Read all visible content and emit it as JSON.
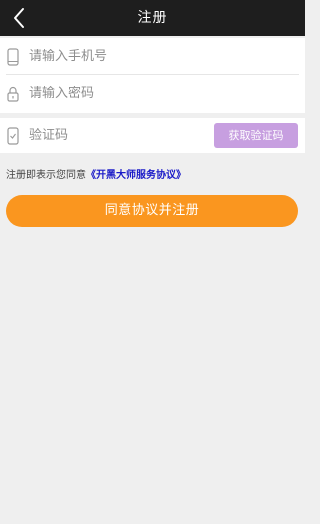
{
  "header": {
    "title": "注册",
    "back_icon": "chevron-left-icon"
  },
  "form": {
    "phone": {
      "placeholder": "请输入手机号",
      "icon": "phone-icon"
    },
    "password": {
      "placeholder": "请输入密码",
      "icon": "lock-icon"
    },
    "code": {
      "placeholder": "验证码",
      "icon": "mobile-code-icon",
      "button_label": "获取验证码"
    }
  },
  "agreement": {
    "prefix": "注册即表示您同意",
    "link": "《开黑大师服务协议》"
  },
  "submit": {
    "label": "同意协议并注册"
  },
  "colors": {
    "header_bg": "#1e1e1e",
    "code_button": "#c79fe0",
    "submit_button": "#fa961f",
    "agreement_link": "#1a1ac8",
    "page_bg": "#efefef"
  }
}
